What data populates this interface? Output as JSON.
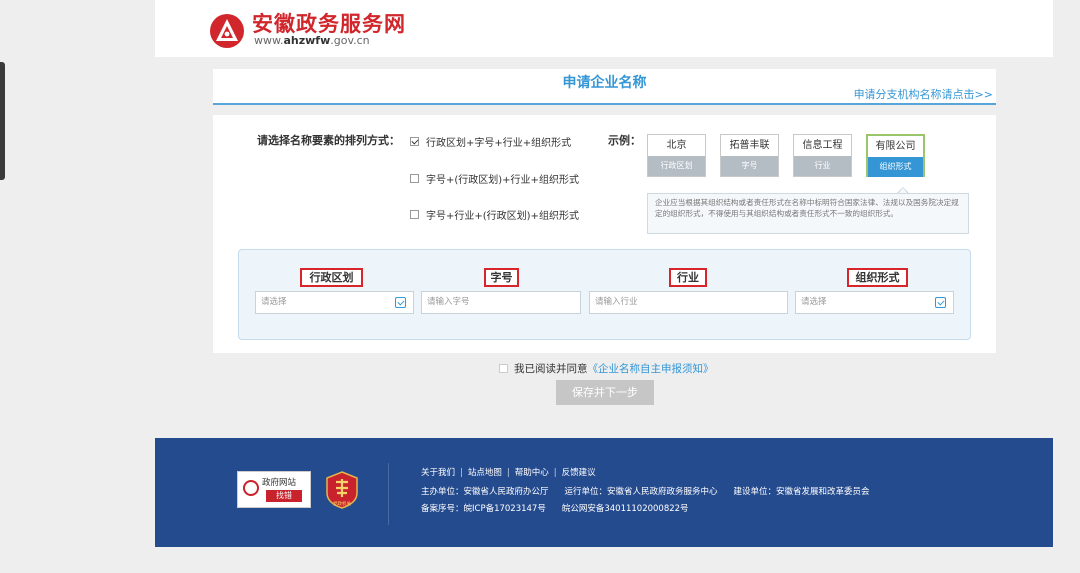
{
  "header": {
    "site_title": "安徽政务服务网",
    "site_url_prefix": "www.",
    "site_url_bold": "ahzwfw",
    "site_url_suffix": ".gov.cn"
  },
  "form": {
    "title": "申请企业名称",
    "branch_link": "申请分支机构名称请点击>>",
    "arrangement_label": "请选择名称要素的排列方式：",
    "options": [
      {
        "label": "行政区划+字号+行业+组织形式",
        "checked": true
      },
      {
        "label": "字号+(行政区划)+行业+组织形式",
        "checked": false
      },
      {
        "label": "字号+行业+(行政区划)+组织形式",
        "checked": false
      }
    ],
    "example_label": "示例：",
    "examples": [
      {
        "value": "北京",
        "type": "行政区划"
      },
      {
        "value": "拓普丰联",
        "type": "字号"
      },
      {
        "value": "信息工程",
        "type": "行业"
      },
      {
        "value": "有限公司",
        "type": "组织形式"
      }
    ],
    "tip": "企业应当根据其组织结构或者责任形式在名称中标明符合国家法律、法规以及国务院决定规定的组织形式，不得使用与其组织结构或者责任形式不一致的组织形式。",
    "fields": [
      {
        "label": "行政区划",
        "placeholder": "请选择"
      },
      {
        "label": "字号",
        "placeholder": "请输入字号"
      },
      {
        "label": "行业",
        "placeholder": "请输入行业"
      },
      {
        "label": "组织形式",
        "placeholder": "请选择"
      }
    ],
    "agree_text": "我已阅读并同意",
    "agree_link": "《企业名称自主申报须知》",
    "save_button": "保存并下一步"
  },
  "footer": {
    "badge_gov_line1": "政府网站",
    "badge_gov_line2": "找错",
    "badge_seal_text": "党政机关",
    "links": [
      "关于我们",
      "站点地图",
      "帮助中心",
      "反馈建议"
    ],
    "sponsor": "主办单位：安徽省人民政府办公厅",
    "operator": "运行单位：安徽省人民政府政务服务中心",
    "builder": "建设单位：安徽省发展和改革委员会",
    "icp": "备案序号：皖ICP备17023147号",
    "police": "皖公网安备34011102000822号"
  },
  "colors": {
    "brand_red": "#d0262c",
    "link_blue": "#3596d6",
    "footer_blue": "#254b8f"
  }
}
